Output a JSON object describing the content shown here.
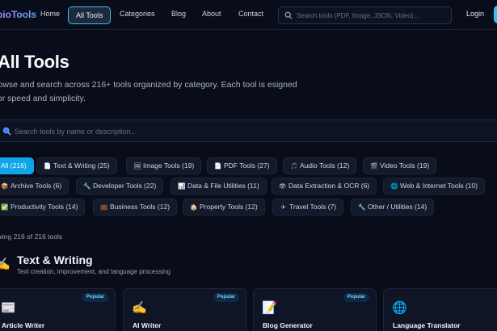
{
  "nav": {
    "logo": "pioTools",
    "links": [
      "Home",
      "All Tools",
      "Categories",
      "Blog",
      "About",
      "Contact"
    ],
    "search_placeholder": "Search tools (PDF, Image, JSON, Video)...",
    "login_label": "Login"
  },
  "header": {
    "title": "All Tools",
    "description": "rowse and search across 216+ tools organized by category. Each tool is esigned for speed and simplicity."
  },
  "main_search": {
    "placeholder": "Search tools by name or description..."
  },
  "categories": [
    {
      "icon": "",
      "label": "All (216)",
      "active": true
    },
    {
      "icon": "📄",
      "label": "Text & Writing (25)"
    },
    {
      "icon": "🖼",
      "label": "Image Tools (19)"
    },
    {
      "icon": "📄",
      "label": "PDF Tools (27)"
    },
    {
      "icon": "🎵",
      "label": "Audio Tools (12)"
    },
    {
      "icon": "🎬",
      "label": "Video Tools (19)"
    },
    {
      "icon": "📦",
      "label": "Archive Tools (6)"
    },
    {
      "icon": "🔧",
      "label": "Developer Tools (22)"
    },
    {
      "icon": "📊",
      "label": "Data & File Utilities (11)"
    },
    {
      "icon": "👁",
      "label": "Data Extraction & OCR (6)"
    },
    {
      "icon": "🌐",
      "label": "Web & Internet Tools (10)"
    },
    {
      "icon": "✅",
      "label": "Productivity Tools (14)"
    },
    {
      "icon": "💼",
      "label": "Business Tools (12)"
    },
    {
      "icon": "🏠",
      "label": "Property Tools (12)"
    },
    {
      "icon": "✈",
      "label": "Travel Tools (7)"
    },
    {
      "icon": "🔧",
      "label": "Other / Utilities (14)"
    }
  ],
  "showing": "owing 216 of 216 tools",
  "section": {
    "icon": "✍",
    "title": "Text & Writing",
    "subtitle": "Text creation, improvement, and language processing"
  },
  "cards": [
    {
      "icon": "📰",
      "name": "Article Writer",
      "badge": "Popular"
    },
    {
      "icon": "✍",
      "name": "AI Writer",
      "badge": "Popular"
    },
    {
      "icon": "📝",
      "name": "Blog Generator",
      "badge": "Popular"
    },
    {
      "icon": "🌐",
      "name": "Language Translator",
      "badge": ""
    }
  ],
  "colors": {
    "accent": "#0ea5e9",
    "background": "#090d1a",
    "logo": "#a78bfa"
  }
}
